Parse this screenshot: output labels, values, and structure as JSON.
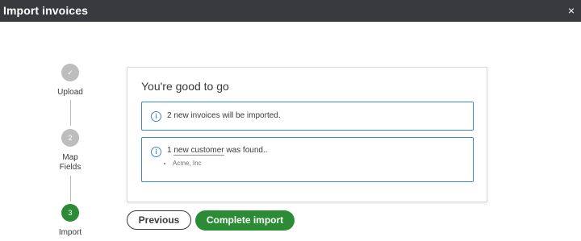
{
  "window": {
    "title": "Import invoices",
    "close_glyph": "×"
  },
  "stepper": {
    "steps": [
      {
        "number": "✓",
        "label": "Upload",
        "state": "done"
      },
      {
        "number": "2",
        "label": "Map Fields",
        "state": "pending"
      },
      {
        "number": "3",
        "label": "Import",
        "state": "active"
      }
    ]
  },
  "card": {
    "heading": "You're good to go",
    "notice_1": {
      "icon": "info-icon",
      "text": "2 new invoices will be imported."
    },
    "notice_2": {
      "icon": "info-icon",
      "prefix": "1 ",
      "link": "new customer",
      "suffix": " was found..",
      "items": [
        "Acme, Inc"
      ]
    }
  },
  "buttons": {
    "previous": "Previous",
    "complete": "Complete import"
  },
  "colors": {
    "accent_green": "#2c8c36",
    "info_blue": "#3e86c7",
    "titlebar": "#393a3d"
  }
}
